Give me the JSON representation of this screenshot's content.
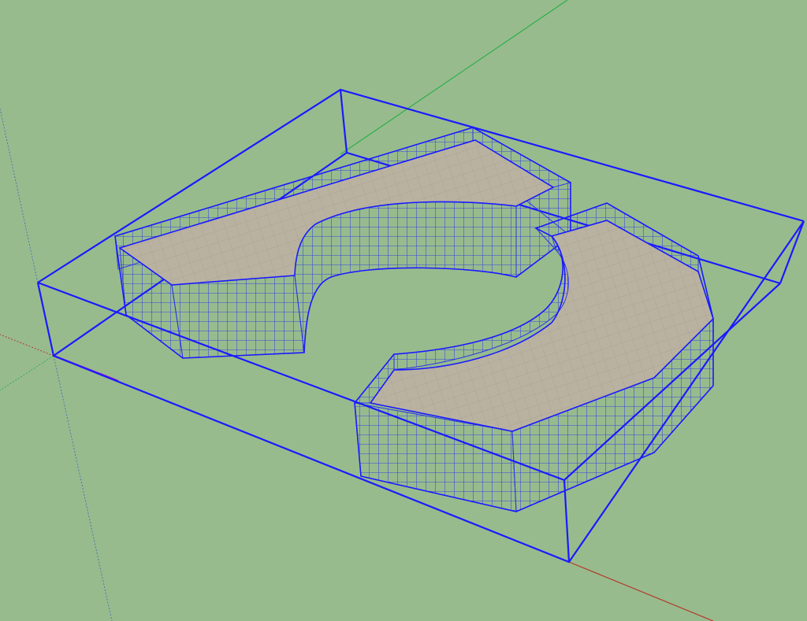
{
  "scene": {
    "background_color": "#98bb8e",
    "colors": {
      "selection_blue": "#1a1aff",
      "grid_blue": "#2a37e6",
      "surface_fill": "#bab2a0",
      "axis_red": "#b03a2a",
      "axis_green": "#2bb04a",
      "axis_blue_dotted": "#4a7aaa",
      "axis_magenta": "#a020c0"
    },
    "objects": {
      "bounding_box": "selection-bounding-box",
      "left_piece": "left-extruded-shape",
      "right_piece": "right-extruded-shape"
    },
    "axes": [
      "red-axis",
      "green-axis",
      "blue-axis"
    ]
  }
}
